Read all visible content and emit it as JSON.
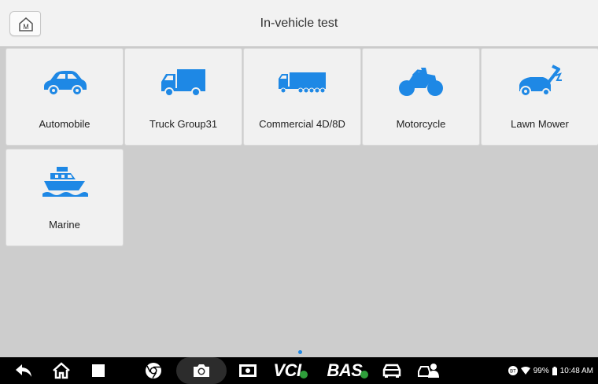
{
  "header": {
    "title": "In-vehicle test",
    "home_badge": "M"
  },
  "tiles": [
    {
      "label": "Automobile",
      "icon": "car-icon"
    },
    {
      "label": "Truck Group31",
      "icon": "truck-icon"
    },
    {
      "label": "Commercial 4D/8D",
      "icon": "semi-trailer-icon"
    },
    {
      "label": "Motorcycle",
      "icon": "motorcycle-icon"
    },
    {
      "label": "Lawn Mower",
      "icon": "lawn-mower-icon"
    },
    {
      "label": "Marine",
      "icon": "boat-icon"
    }
  ],
  "navbar": {
    "vci_label": "VCI",
    "bas_label": "BAS",
    "battery": "99%",
    "time": "10:48 AM"
  },
  "colors": {
    "accent": "#1e88e5",
    "tile_bg": "#f1f1f1",
    "page_bg": "#cdcdcd"
  }
}
